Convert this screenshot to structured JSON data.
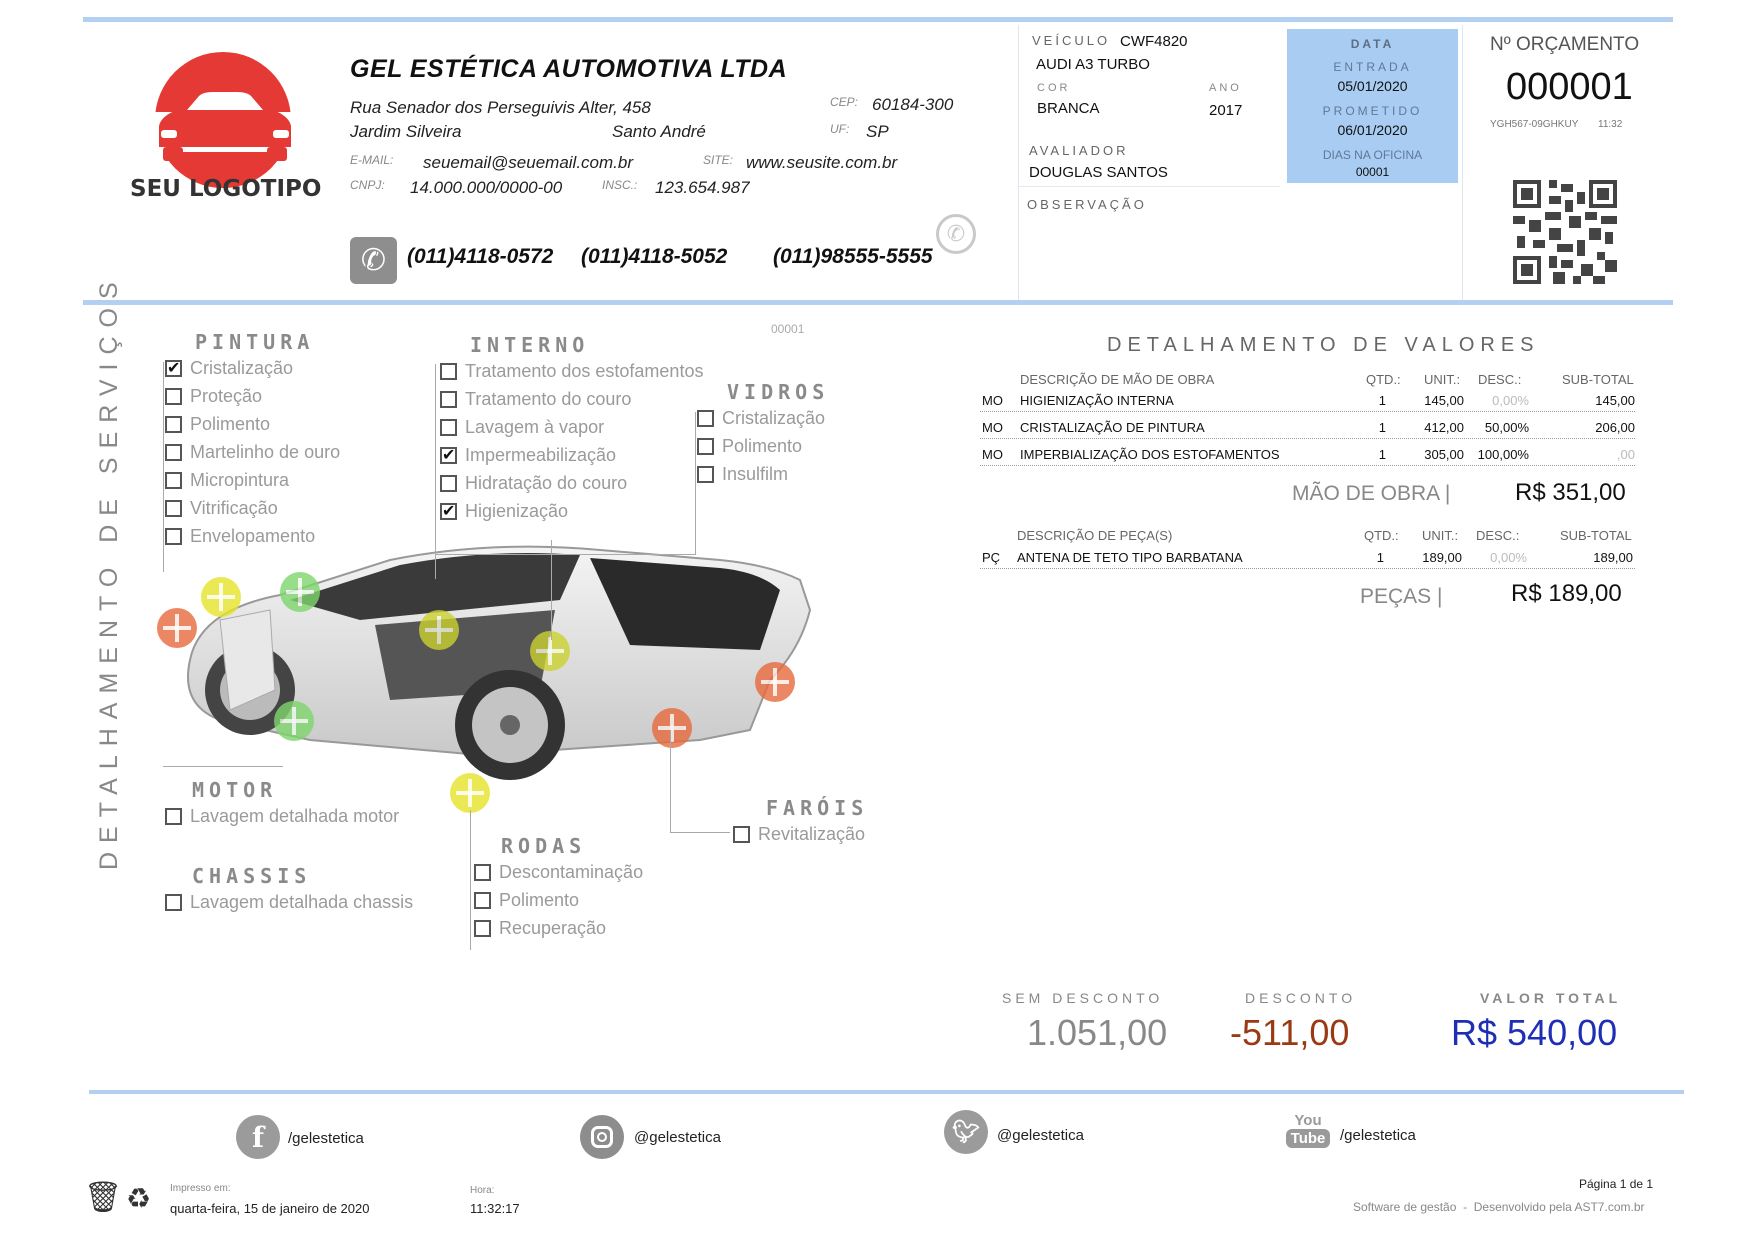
{
  "company": {
    "logo_text": "SEU LOGOTIPO",
    "name": "GEL ESTÉTICA AUTOMOTIVA LTDA",
    "street": "Rua Senador dos Perseguivis Alter, 458",
    "district": "Jardim Silveira",
    "city": "Santo André",
    "cep_label": "CEP:",
    "cep": "60184-300",
    "uf_label": "UF:",
    "uf": "SP",
    "email_label": "E-MAIL:",
    "email": "seuemail@seuemail.com.br",
    "site_label": "SITE:",
    "site": "www.seusite.com.br",
    "cnpj_label": "CNPJ:",
    "cnpj": "14.000.000/0000-00",
    "insc_label": "INSC.:",
    "insc": "123.654.987",
    "phones": [
      "(011)4118-0572",
      "(011)4118-5052",
      "(011)98555-5555"
    ]
  },
  "vehicle": {
    "veiculo_label": "VEÍCULO",
    "plate": "CWF4820",
    "model": "AUDI A3 TURBO",
    "cor_label": "COR",
    "cor": "BRANCA",
    "ano_label": "ANO",
    "ano": "2017",
    "avaliador_label": "AVALIADOR",
    "avaliador": "DOUGLAS SANTOS",
    "observacao_label": "OBSERVAÇÃO"
  },
  "dates": {
    "title": "DATA",
    "entrada_label": "ENTRADA",
    "entrada": "05/01/2020",
    "prometido_label": "PROMETIDO",
    "prometido": "06/01/2020",
    "dias_label": "DIAS NA OFICINA",
    "dias": "00001"
  },
  "budget": {
    "label": "Nº ORÇAMENTO",
    "number": "000001",
    "code": "YGH567-09GHKUY",
    "time": "11:32"
  },
  "services": {
    "side_title": "DETALHAMENTO DE SERVIÇOS",
    "order_ref": "00001",
    "pintura": {
      "title": "PINTURA",
      "items": [
        {
          "label": "Cristalização",
          "checked": true
        },
        {
          "label": "Proteção",
          "checked": false
        },
        {
          "label": "Polimento",
          "checked": false
        },
        {
          "label": "Martelinho de ouro",
          "checked": false
        },
        {
          "label": "Micropintura",
          "checked": false
        },
        {
          "label": "Vitrificação",
          "checked": false
        },
        {
          "label": "Envelopamento",
          "checked": false
        }
      ]
    },
    "interno": {
      "title": "INTERNO",
      "items": [
        {
          "label": "Tratamento dos estofamentos",
          "checked": false
        },
        {
          "label": "Tratamento do couro",
          "checked": false
        },
        {
          "label": "Lavagem à vapor",
          "checked": false
        },
        {
          "label": "Impermeabilização",
          "checked": true
        },
        {
          "label": "Hidratação do couro",
          "checked": false
        },
        {
          "label": "Higienização",
          "checked": true
        }
      ]
    },
    "vidros": {
      "title": "VIDROS",
      "items": [
        {
          "label": "Cristalização",
          "checked": false
        },
        {
          "label": "Polimento",
          "checked": false
        },
        {
          "label": "Insulfilm",
          "checked": false
        }
      ]
    },
    "motor": {
      "title": "MOTOR",
      "items": [
        {
          "label": "Lavagem detalhada motor",
          "checked": false
        }
      ]
    },
    "chassis": {
      "title": "CHASSIS",
      "items": [
        {
          "label": "Lavagem detalhada chassis",
          "checked": false
        }
      ]
    },
    "rodas": {
      "title": "RODAS",
      "items": [
        {
          "label": "Descontaminação",
          "checked": false
        },
        {
          "label": "Polimento",
          "checked": false
        },
        {
          "label": "Recuperação",
          "checked": false
        }
      ]
    },
    "farois": {
      "title": "FARÓIS",
      "items": [
        {
          "label": "Revitalização",
          "checked": false
        }
      ]
    }
  },
  "values": {
    "title": "DETALHAMENTO DE VALORES",
    "labor_headers": {
      "desc": "DESCRIÇÃO DE MÃO DE OBRA",
      "qtd": "QTD.:",
      "unit": "UNIT.:",
      "desc_pct": "DESC.:",
      "sub": "SUB-TOTAL"
    },
    "labor_rows": [
      {
        "type": "MO",
        "desc": "HIGIENIZAÇÃO INTERNA",
        "qtd": "1",
        "unit": "145,00",
        "discount": "0,00%",
        "sub": "145,00",
        "disc_muted": true,
        "sub_muted": false
      },
      {
        "type": "MO",
        "desc": "CRISTALIZAÇÃO DE PINTURA",
        "qtd": "1",
        "unit": "412,00",
        "discount": "50,00%",
        "sub": "206,00",
        "disc_muted": false,
        "sub_muted": false
      },
      {
        "type": "MO",
        "desc": "IMPERBIALIZAÇÃO DOS ESTOFAMENTOS",
        "qtd": "1",
        "unit": "305,00",
        "discount": "100,00%",
        "sub": ",00",
        "disc_muted": false,
        "sub_muted": true
      }
    ],
    "labor_total_label": "MÃO DE OBRA |",
    "labor_total": "R$ 351,00",
    "parts_headers": {
      "desc": "DESCRIÇÃO DE PEÇA(S)",
      "qtd": "QTD.:",
      "unit": "UNIT.:",
      "desc_pct": "DESC.:",
      "sub": "SUB-TOTAL"
    },
    "parts_rows": [
      {
        "type": "PÇ",
        "desc": "ANTENA DE TETO TIPO BARBATANA",
        "qtd": "1",
        "unit": "189,00",
        "discount": "0,00%",
        "sub": "189,00",
        "disc_muted": true,
        "sub_muted": false
      }
    ],
    "parts_total_label": "PEÇAS |",
    "parts_total": "R$ 189,00"
  },
  "summary": {
    "sem_desconto_label": "SEM DESCONTO",
    "sem_desconto": "1.051,00",
    "desconto_label": "DESCONTO",
    "desconto": "-511,00",
    "total_label": "VALOR TOTAL",
    "total": "R$ 540,00",
    "colors": {
      "desconto": "#9a3a12",
      "total": "#1f2fb5"
    }
  },
  "social": {
    "facebook": "/gelestetica",
    "instagram": "@gelestetica",
    "twitter": "@gelestetica",
    "youtube": "/gelestetica"
  },
  "footer": {
    "impresso_label": "Impresso em:",
    "impresso": "quarta-feira, 15 de janeiro de 2020",
    "hora_label": "Hora:",
    "hora": "11:32:17",
    "page": "Página 1 de 1",
    "credit": "Software de gestão  -  Desenvolvido pela AST7.com.br"
  },
  "colors": {
    "accent": "#b3d0f2",
    "date_box": "#a9ccf2",
    "logo_red": "#e53935"
  }
}
